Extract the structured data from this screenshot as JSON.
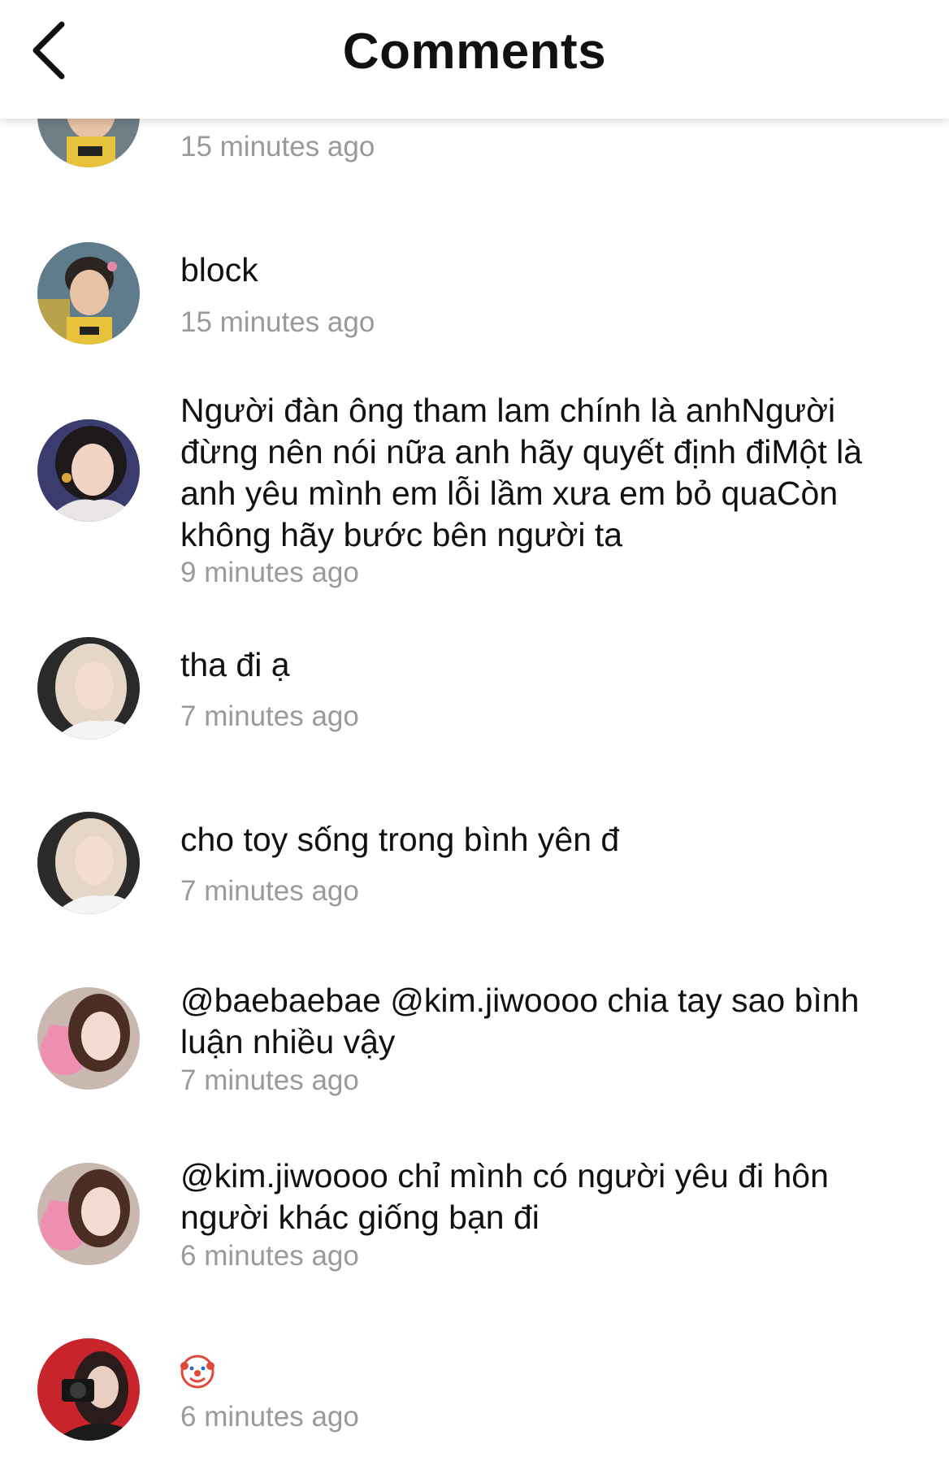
{
  "header": {
    "title": "Comments"
  },
  "comments": [
    {
      "text": "",
      "time": "15 minutes ago"
    },
    {
      "text": "block",
      "time": "15 minutes ago"
    },
    {
      "text": "Người đàn ông tham lam chính là anhNgười đừng nên nói nữa anh hãy quyết định điMột là anh yêu mình em lỗi lầm xưa em bỏ quaCòn không hãy bước bên người ta",
      "time": "9 minutes ago"
    },
    {
      "text": "tha đi ạ",
      "time": "7 minutes ago"
    },
    {
      "text": "cho toy sống trong bình yên đ",
      "time": "7 minutes ago"
    },
    {
      "text": "@baebaebae @kim.jiwoooo chia tay sao bình luận nhiều vậy",
      "time": "7 minutes ago"
    },
    {
      "text": "@kim.jiwoooo chỉ mình có người yêu đi hôn người khác giống bạn đi",
      "time": "6 minutes ago"
    },
    {
      "text": "",
      "emoji": "clown-face",
      "time": "6 minutes ago"
    }
  ],
  "colors": {
    "text": "#111111",
    "timestamp": "#9a9a9a",
    "background": "#ffffff"
  }
}
